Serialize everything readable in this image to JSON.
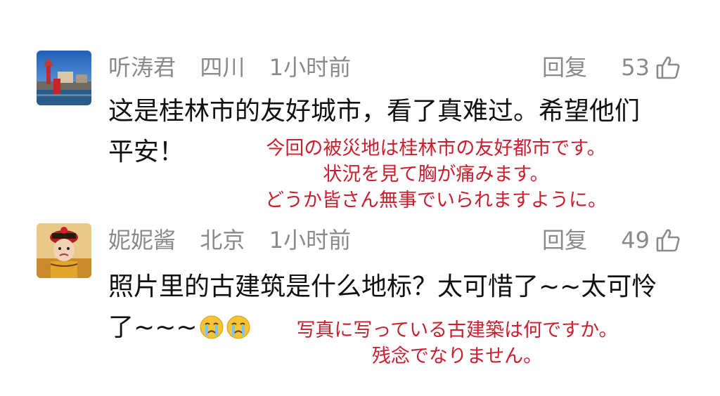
{
  "comments": [
    {
      "username": "听涛君",
      "location": "四川",
      "time": "1小时前",
      "reply_label": "回复",
      "likes": "53",
      "text_line1": "这是桂林市的友好城市，看了真难过。希望他们",
      "text_line2": "平安！",
      "translation": [
        "今回の被災地は桂林市の友好都市です。",
        "状況を見て胸が痛みます。",
        "どうか皆さん無事でいられますように。"
      ],
      "avatar_icon": "avatar-harbor-photo"
    },
    {
      "username": "妮妮酱",
      "location": "北京",
      "time": "1小时前",
      "reply_label": "回复",
      "likes": "49",
      "text_line1": "照片里的古建筑是什么地标？太可惜了~~太可怜",
      "text_line2": "了~~~",
      "translation": [
        "写真に写っている古建築は何ですか。",
        "残念でなりません。"
      ],
      "avatar_icon": "avatar-child-costume-photo",
      "emojis": [
        "crying-face-icon",
        "crying-face-icon"
      ]
    }
  ],
  "colors": {
    "meta": "#8a8a8a",
    "text": "#111111",
    "translation": "#c8202f"
  }
}
